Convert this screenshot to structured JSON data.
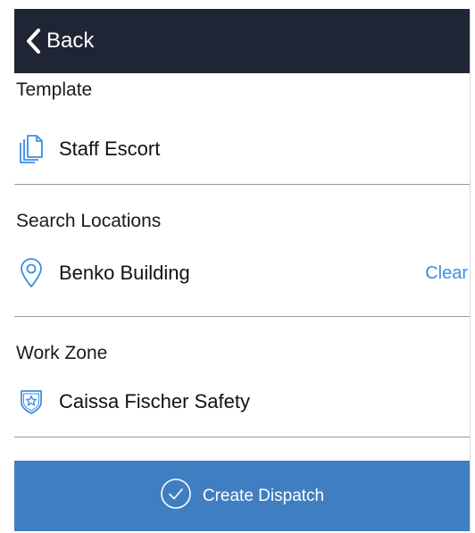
{
  "nav": {
    "back_label": "Back"
  },
  "template": {
    "label": "Template",
    "value": "Staff Escort",
    "icon": "documents-icon"
  },
  "location": {
    "label": "Search Locations",
    "value": "Benko Building",
    "icon": "map-pin-icon",
    "clear_label": "Clear"
  },
  "work_zone": {
    "label": "Work Zone",
    "value": "Caissa Fischer Safety",
    "icon": "shield-star-icon"
  },
  "action": {
    "label": "Create Dispatch",
    "icon": "check-circle-icon"
  },
  "colors": {
    "nav_bg": "#1f2535",
    "accent": "#3a8ee6",
    "action_bg": "#3f7fc1"
  }
}
